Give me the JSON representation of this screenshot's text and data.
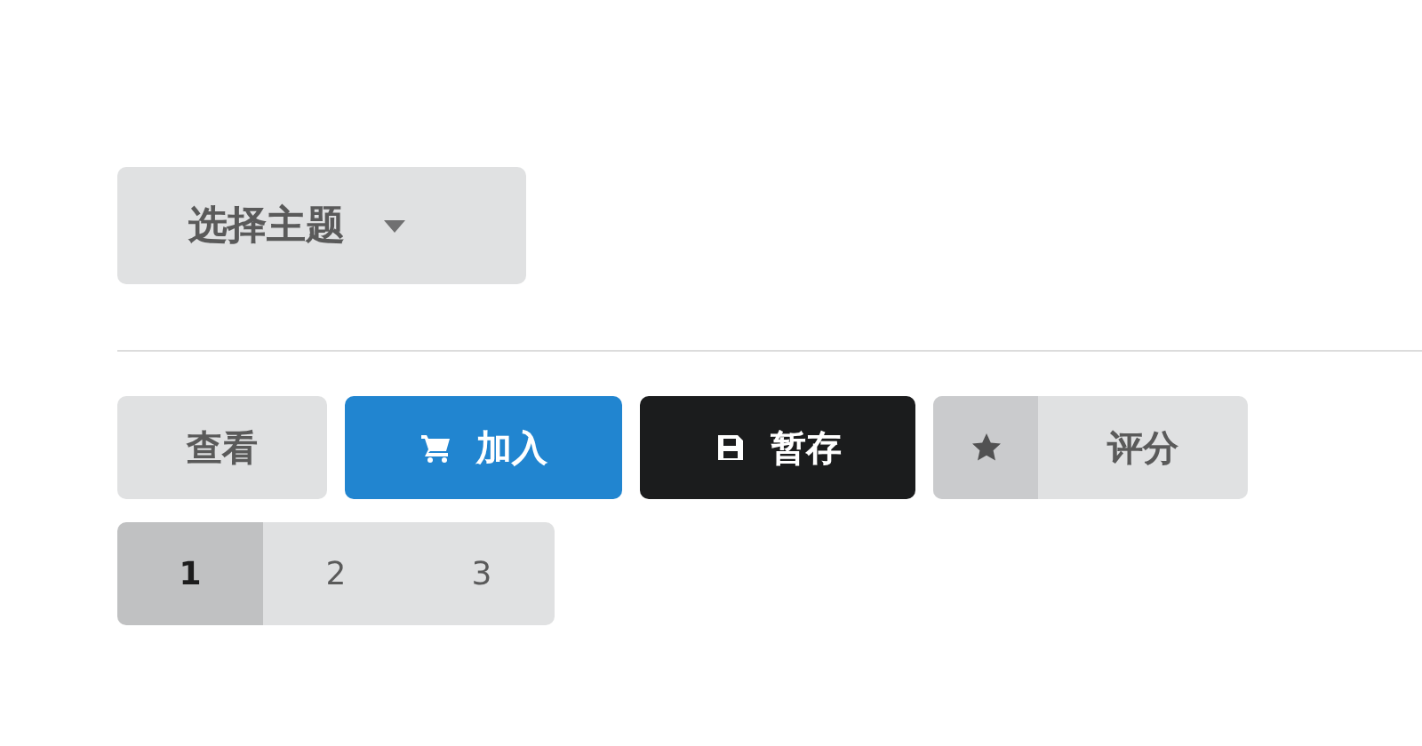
{
  "theme_dropdown": {
    "label": "选择主题"
  },
  "buttons": [
    {
      "kind": "basic",
      "label": "查看"
    },
    {
      "kind": "cart",
      "label": "加入"
    },
    {
      "kind": "save",
      "label": "暂存"
    },
    {
      "kind": "star",
      "label": "评分"
    }
  ],
  "pagination": [
    {
      "label": "1",
      "selected": true
    },
    {
      "label": "2",
      "selected": false
    },
    {
      "label": "3",
      "selected": false
    }
  ]
}
